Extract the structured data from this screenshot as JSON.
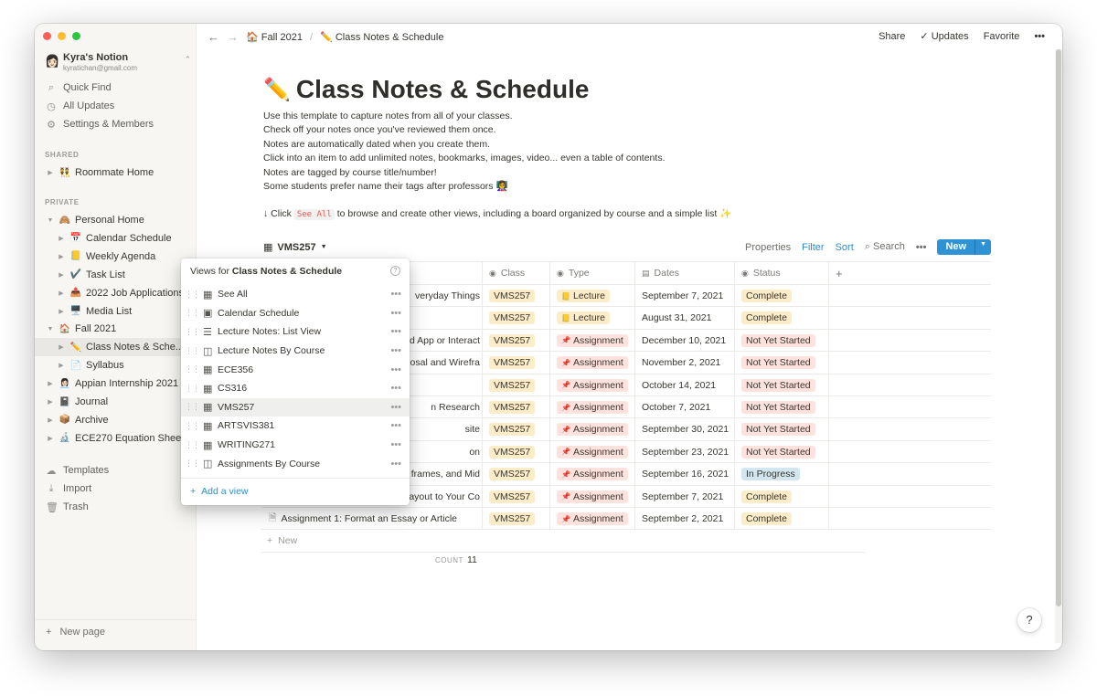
{
  "workspace": {
    "name": "Kyra's Notion",
    "email": "kyratichan@gmail.com",
    "avatar": "👩🏻",
    "switch_icon": "⌃"
  },
  "nav": [
    {
      "icon": "⌕",
      "label": "Quick Find"
    },
    {
      "icon": "◷",
      "label": "All Updates"
    },
    {
      "icon": "⚙",
      "label": "Settings & Members"
    }
  ],
  "sections": {
    "shared": "SHARED",
    "private": "PRIVATE"
  },
  "shared_items": [
    {
      "emoji": "👯",
      "label": "Roommate Home"
    }
  ],
  "private_items": [
    {
      "emoji": "🙈",
      "label": "Personal Home",
      "depth": 0,
      "open": true
    },
    {
      "emoji": "📅",
      "label": "Calendar Schedule",
      "depth": 1
    },
    {
      "emoji": "📒",
      "label": "Weekly Agenda",
      "depth": 1
    },
    {
      "emoji": "✔️",
      "label": "Task List",
      "depth": 1
    },
    {
      "emoji": "📤",
      "label": "2022 Job Applications",
      "depth": 1
    },
    {
      "emoji": "🖥️",
      "label": "Media List",
      "depth": 1
    },
    {
      "emoji": "🏠",
      "label": "Fall 2021",
      "depth": 0,
      "open": true
    },
    {
      "emoji": "✏️",
      "label": "Class Notes & Sche...",
      "depth": 1,
      "active": true
    },
    {
      "emoji": "📄",
      "label": "Syllabus",
      "depth": 1
    },
    {
      "emoji": "👩🏻‍💼",
      "label": "Appian Internship 2021",
      "depth": 0
    },
    {
      "emoji": "📓",
      "label": "Journal",
      "depth": 0
    },
    {
      "emoji": "📦",
      "label": "Archive",
      "depth": 0
    },
    {
      "emoji": "🔬",
      "label": "ECE270 Equation Sheet",
      "depth": 0
    }
  ],
  "bottom_nav": [
    {
      "icon": "☁",
      "label": "Templates"
    },
    {
      "icon": "⤓",
      "label": "Import"
    },
    {
      "icon": "🗑",
      "label": "Trash"
    }
  ],
  "new_page": "New page",
  "breadcrumb": [
    {
      "emoji": "🏠",
      "label": "Fall 2021"
    },
    {
      "emoji": "✏️",
      "label": "Class Notes & Schedule"
    }
  ],
  "top_actions": {
    "share": "Share",
    "updates": "Updates",
    "favorite": "Favorite",
    "more": "•••"
  },
  "page": {
    "emoji": "✏️",
    "title": "Class Notes & Schedule",
    "description": [
      "Use this template to capture notes from all of your classes.",
      "Check off your notes once you've reviewed them once.",
      "Notes are automatically dated when you create them.",
      "Click into an item to add unlimited notes, bookmarks, images, video... even a table of contents.",
      "Notes are tagged by course title/number!",
      "Some students prefer name their tags after professors 👩‍🏫"
    ],
    "hint_pre": "↓ Click ",
    "hint_code": "See All",
    "hint_post": " to browse and create other views, including a board organized by course and a simple list ✨"
  },
  "database": {
    "view_name": "VMS257",
    "tools": {
      "properties": "Properties",
      "filter": "Filter",
      "sort": "Sort",
      "search": "Search",
      "more": "•••",
      "new": "New"
    },
    "columns": [
      "Class",
      "Type",
      "Dates",
      "Status"
    ],
    "rows": [
      {
        "name": "veryday Things",
        "class": "VMS257",
        "type": "Lecture",
        "date": "September 7, 2021",
        "status": "Complete"
      },
      {
        "name": "",
        "class": "VMS257",
        "type": "Lecture",
        "date": "August 31, 2021",
        "status": "Complete"
      },
      {
        "name": "d App or Interact",
        "class": "VMS257",
        "type": "Assignment",
        "date": "December 10, 2021",
        "status": "Not Yet Started"
      },
      {
        "name": "osal and Wirefra",
        "class": "VMS257",
        "type": "Assignment",
        "date": "November 2, 2021",
        "status": "Not Yet Started"
      },
      {
        "name": "",
        "class": "VMS257",
        "type": "Assignment",
        "date": "October 14, 2021",
        "status": "Not Yet Started"
      },
      {
        "name": "n Research",
        "class": "VMS257",
        "type": "Assignment",
        "date": "October 7, 2021",
        "status": "Not Yet Started"
      },
      {
        "name": "site",
        "class": "VMS257",
        "type": "Assignment",
        "date": "September 30, 2021",
        "status": "Not Yet Started"
      },
      {
        "name": "on",
        "class": "VMS257",
        "type": "Assignment",
        "date": "September 23, 2021",
        "status": "Not Yet Started"
      },
      {
        "name": "frames, and Mid",
        "class": "VMS257",
        "type": "Assignment",
        "date": "September 16, 2021",
        "status": "In Progress"
      },
      {
        "name": "ayout to Your Co",
        "class": "VMS257",
        "type": "Assignment",
        "date": "September 7, 2021",
        "status": "Complete"
      },
      {
        "name": "Assignment 1: Format an Essay or Article",
        "class": "VMS257",
        "type": "Assignment",
        "date": "September 2, 2021",
        "status": "Complete"
      }
    ],
    "new_row": "New",
    "count_label": "COUNT",
    "count_value": "11"
  },
  "views_popup": {
    "title_pre": "Views for ",
    "title_bold": "Class Notes & Schedule",
    "views": [
      {
        "icon": "▦",
        "label": "See All"
      },
      {
        "icon": "▣",
        "label": "Calendar Schedule"
      },
      {
        "icon": "☰",
        "label": "Lecture Notes: List View"
      },
      {
        "icon": "◫",
        "label": "Lecture Notes By Course"
      },
      {
        "icon": "▦",
        "label": "ECE356"
      },
      {
        "icon": "▦",
        "label": "CS316"
      },
      {
        "icon": "▦",
        "label": "VMS257",
        "active": true
      },
      {
        "icon": "▦",
        "label": "ARTSVIS381"
      },
      {
        "icon": "▦",
        "label": "WRITING271"
      },
      {
        "icon": "◫",
        "label": "Assignments By Course"
      }
    ],
    "add_view": "Add a view"
  },
  "help": "?"
}
